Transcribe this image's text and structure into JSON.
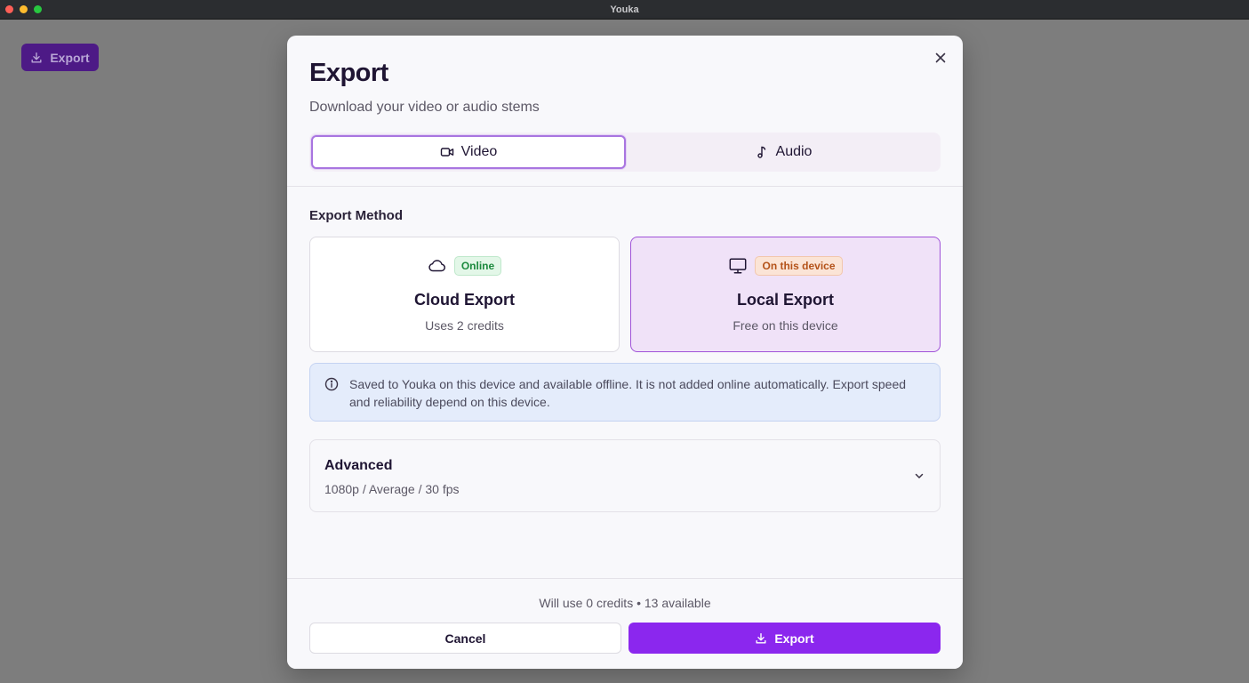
{
  "window": {
    "title": "Youka"
  },
  "background": {
    "export_label": "Export",
    "export_icon": "download-icon"
  },
  "dialog": {
    "title": "Export",
    "subtitle": "Download your video or audio stems",
    "close_icon": "close-icon",
    "tabs": [
      {
        "label": "Video",
        "icon": "video-camera-icon",
        "selected": true
      },
      {
        "label": "Audio",
        "icon": "music-note-icon",
        "selected": false
      }
    ],
    "export_method": {
      "label": "Export Method",
      "options": [
        {
          "title": "Cloud Export",
          "subtitle": "Uses 2 credits",
          "badge": "Online",
          "icon": "cloud-icon",
          "selected": false
        },
        {
          "title": "Local Export",
          "subtitle": "Free on this device",
          "badge": "On this device",
          "icon": "monitor-icon",
          "selected": true
        }
      ]
    },
    "info": {
      "icon": "info-icon",
      "text": "Saved to Youka on this device and available offline. It is not added online automatically. Export speed and reliability depend on this device."
    },
    "advanced": {
      "title": "Advanced",
      "summary": "1080p / Average / 30 fps",
      "icon": "chevron-down-icon"
    },
    "footer": {
      "credits_text": "Will use 0 credits • 13 available",
      "cancel_label": "Cancel",
      "export_label": "Export"
    }
  },
  "colors": {
    "accent": "#8b27ee",
    "selected_card_bg": "#f0e2f8",
    "online_badge": "#1c8a3e",
    "device_badge": "#b4531a"
  }
}
